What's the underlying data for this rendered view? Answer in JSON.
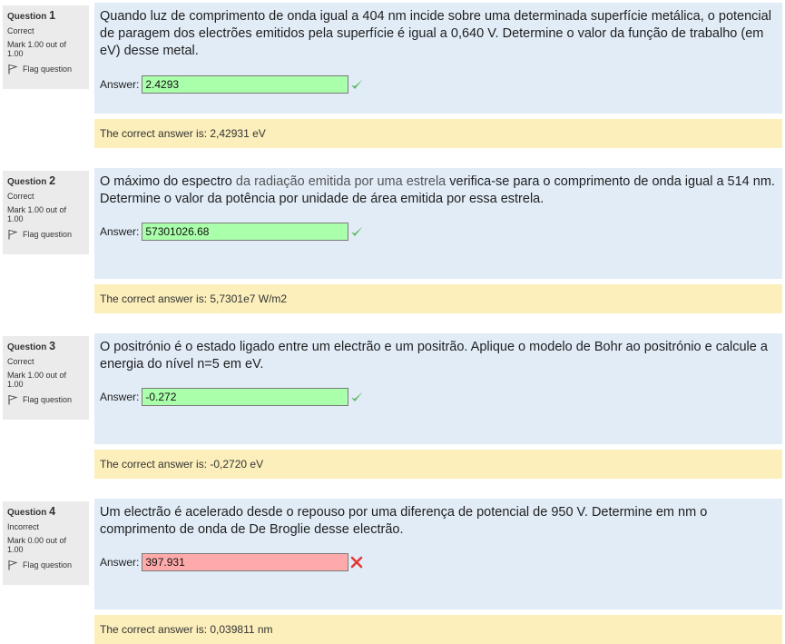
{
  "questions": [
    {
      "label": "Question",
      "number": "1",
      "state": "Correct",
      "grade": "Mark 1.00 out of 1.00",
      "flag_label": "Flag question",
      "text_parts": [
        "Quando luz de comprimento de onda igual a 404 nm incide sobre uma determinada superfície metálica, o potencial de paragem dos electrões emitidos pela superfície é igual a 0,640 V. Determine o valor da função de trabalho (em eV) desse metal.",
        "",
        ""
      ],
      "answer_label": "Answer:",
      "answer_value": "2.4293",
      "result": "correct",
      "right_answer": "The correct answer is: 2,42931 eV"
    },
    {
      "label": "Question",
      "number": "2",
      "state": "Correct",
      "grade": "Mark 1.00 out of 1.00",
      "flag_label": "Flag question",
      "text_parts": [
        "O máximo do espectro ",
        "da radiação emitida por uma estrela",
        " verifica-se para o comprimento de onda igual a 514 nm. Determine o valor da potência por unidade de área emitida por essa estrela."
      ],
      "answer_label": "Answer:",
      "answer_value": "57301026.68",
      "result": "correct",
      "right_answer": "The correct answer is: 5,7301e7 W/m2"
    },
    {
      "label": "Question",
      "number": "3",
      "state": "Correct",
      "grade": "Mark 1.00 out of 1.00",
      "flag_label": "Flag question",
      "text_parts": [
        "O positrónio é o estado ligado entre um electrão e um positrão. Aplique o modelo de Bohr ao positrónio e calcule a energia do nível n=5 em eV.",
        "",
        ""
      ],
      "answer_label": "Answer:",
      "answer_value": "-0.272",
      "result": "correct",
      "right_answer": "The correct answer is: -0,2720 eV"
    },
    {
      "label": "Question",
      "number": "4",
      "state": "Incorrect",
      "grade": "Mark 0.00 out of 1.00",
      "flag_label": "Flag question",
      "text_parts": [
        "Um electrão é acelerado desde o repouso por uma diferença de potencial de 950 V. Determine em nm o comprimento de onda de De Broglie desse electrão.",
        "",
        ""
      ],
      "answer_label": "Answer:",
      "answer_value": "397.931",
      "result": "incorrect",
      "right_answer": "The correct answer is: 0,039811 nm"
    }
  ],
  "icons": {
    "correct": "check-icon",
    "incorrect": "cross-icon",
    "flag": "flag-icon"
  },
  "colors": {
    "correct_bg": "#aaffaa",
    "incorrect_bg": "#ffaaaa",
    "check": "#5cb85c",
    "cross": "#e53935"
  }
}
